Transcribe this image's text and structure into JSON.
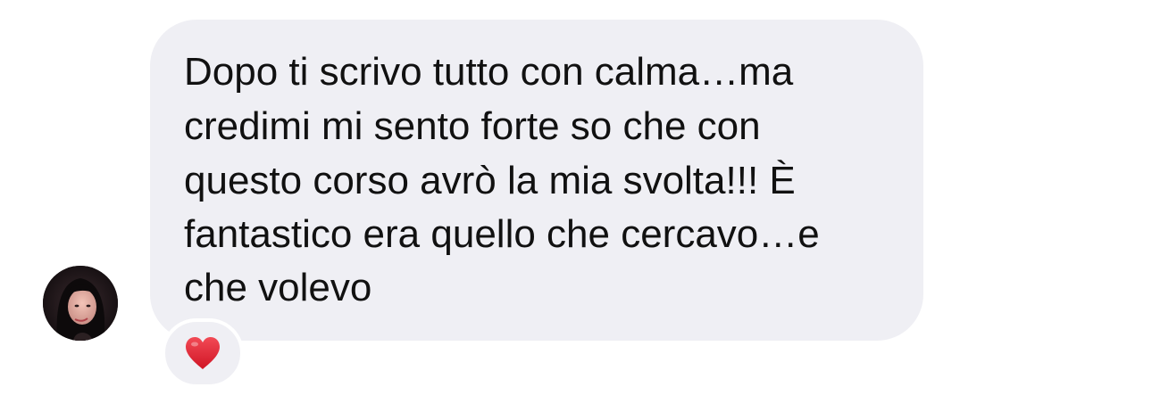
{
  "message": {
    "lines": [
      "Dopo ti scrivo tutto con calma…ma",
      "credimi mi sento forte so che con",
      "questo corso avrò la mia svolta!!! È",
      "fantastico era quello che cercavo…e",
      "che volevo"
    ]
  },
  "sender": {
    "avatar_icon": "user-avatar-photo"
  },
  "reaction": {
    "icon": "red-heart-icon",
    "color": "#e0202e"
  },
  "colors": {
    "bubble": "#efeff4",
    "text": "#111111",
    "background": "#ffffff"
  }
}
